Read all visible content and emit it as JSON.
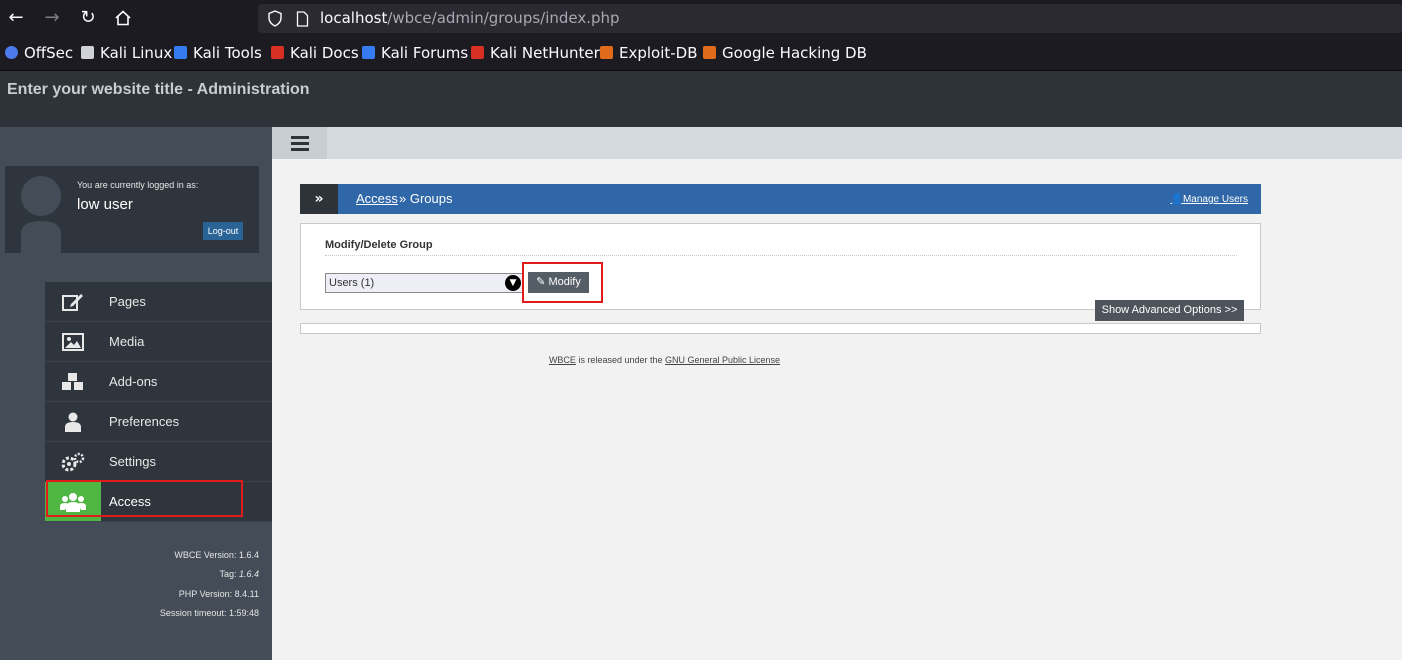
{
  "browser": {
    "url_host": "localhost",
    "url_path": "/wbce/admin/groups/index.php",
    "bookmarks": [
      {
        "label": "OffSec",
        "color": "#4b7bec"
      },
      {
        "label": "Kali Linux",
        "color": "#cfd3d8"
      },
      {
        "label": "Kali Tools",
        "color": "#367bf0"
      },
      {
        "label": "Kali Docs",
        "color": "#d93025"
      },
      {
        "label": "Kali Forums",
        "color": "#367bf0"
      },
      {
        "label": "Kali NetHunter",
        "color": "#d93025"
      },
      {
        "label": "Exploit-DB",
        "color": "#e06b1b"
      },
      {
        "label": "Google Hacking DB",
        "color": "#e06b1b"
      }
    ]
  },
  "header": {
    "site_title": "Enter your website title - Administration"
  },
  "sidebar": {
    "logged_in_label": "You are currently logged in as:",
    "user_name": "low user",
    "logout_label": "Log-out",
    "menu": [
      {
        "label": "Pages",
        "icon": "edit-icon"
      },
      {
        "label": "Media",
        "icon": "image-icon"
      },
      {
        "label": "Add-ons",
        "icon": "cubes-icon"
      },
      {
        "label": "Preferences",
        "icon": "user-icon"
      },
      {
        "label": "Settings",
        "icon": "gears-icon"
      },
      {
        "label": "Access",
        "icon": "users-icon",
        "active": true
      }
    ],
    "version_info": {
      "wbce_label": "WBCE Version:",
      "wbce_value": "1.6.4",
      "tag_label": "Tag:",
      "tag_value": "1.6.4",
      "php_label": "PHP Version:",
      "php_value": "8.4.11",
      "session_label": "Session timeout:",
      "session_value": "1:59:48"
    }
  },
  "main": {
    "breadcrumb": {
      "access": "Access",
      "separator_and_current": "» Groups",
      "manage_users": "Manage Users"
    },
    "panel": {
      "title": "Modify/Delete Group",
      "selected_group": "Users (1)",
      "modify_label": "Modify",
      "advanced_label": "Show Advanced Options >>"
    },
    "footer": {
      "wbce": "WBCE",
      "middle": " is released under the ",
      "license": "GNU General Public License"
    }
  },
  "colors": {
    "accent_blue": "#2f67a8",
    "active_green": "#4fb543",
    "highlight_red": "#e01b1b"
  }
}
